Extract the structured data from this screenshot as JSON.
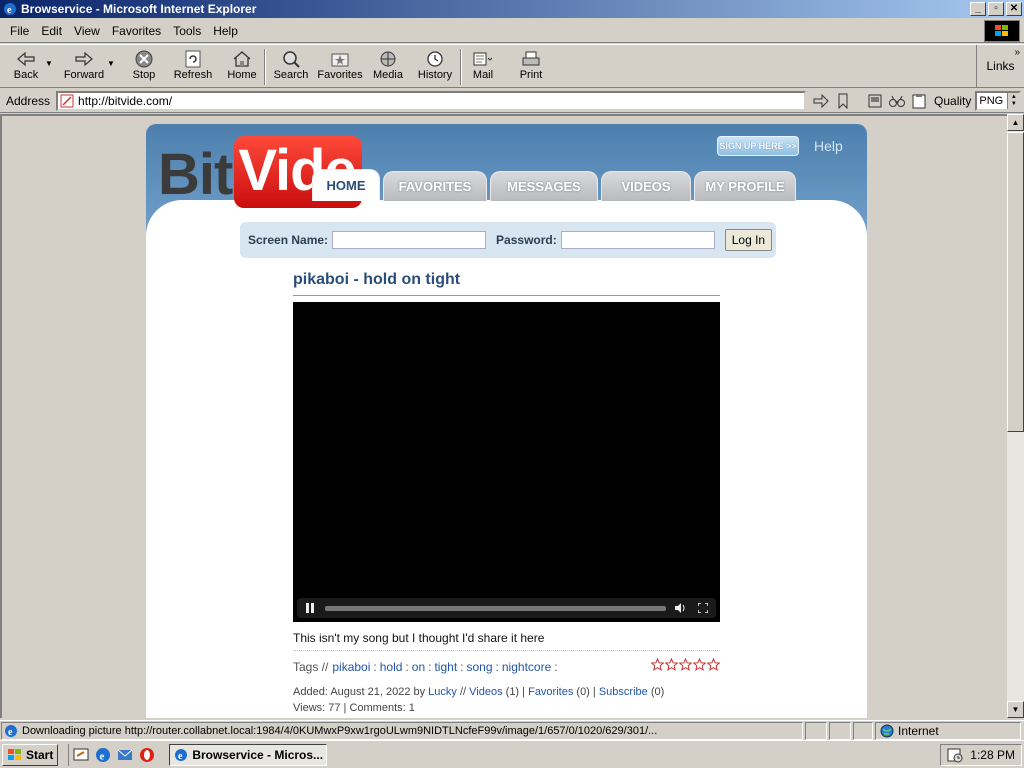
{
  "window": {
    "title": "Browservice - Microsoft Internet Explorer",
    "buttons": [
      "_",
      "▫",
      "✕"
    ]
  },
  "menu": [
    "File",
    "Edit",
    "View",
    "Favorites",
    "Tools",
    "Help"
  ],
  "toolbar": {
    "back": "Back",
    "forward": "Forward",
    "stop": "Stop",
    "refresh": "Refresh",
    "home": "Home",
    "search": "Search",
    "favorites": "Favorites",
    "media": "Media",
    "history": "History",
    "mail": "Mail",
    "print": "Print",
    "links": "Links",
    "chevron": "»"
  },
  "address": {
    "label": "Address",
    "url": "http://bitvide.com/",
    "quality_label": "Quality",
    "quality_value": "PNG"
  },
  "site": {
    "logo_bit": "Bit",
    "logo_vide": "Vide",
    "signup": "SIGN UP HERE >>",
    "help": "Help",
    "tabs": [
      "HOME",
      "FAVORITES",
      "MESSAGES",
      "VIDEOS",
      "MY PROFILE"
    ],
    "active_tab": "HOME",
    "login": {
      "screen_name_label": "Screen Name:",
      "password_label": "Password:",
      "button": "Log In"
    },
    "video": {
      "title": "pikaboi - hold on tight",
      "description": "This isn't my song but I thought I'd share it here",
      "tags_label": "Tags //",
      "tags": [
        "pikaboi",
        "hold",
        "on",
        "tight",
        "song",
        "nightcore"
      ],
      "tag_separator": ":",
      "rating_stars": 5,
      "added_prefix": "Added: August 21, 2022 by",
      "author": "Lucky",
      "videos_link": "Videos",
      "videos_count": "(1)",
      "favorites_link": "Favorites",
      "favorites_count": "(0)",
      "subscribe_link": "Subscribe",
      "subscribe_count": "(0)",
      "views_line": "Views: 77 | Comments: 1"
    }
  },
  "status": {
    "text": "Downloading picture http://router.collabnet.local:1984/4/0KUMwxP9xw1rgoULwm9NIDTLNcfeF99v/image/1/657/0/1020/629/301/...",
    "zone": "Internet"
  },
  "taskbar": {
    "start": "Start",
    "task": "Browservice - Micros...",
    "clock": "1:28 PM"
  }
}
